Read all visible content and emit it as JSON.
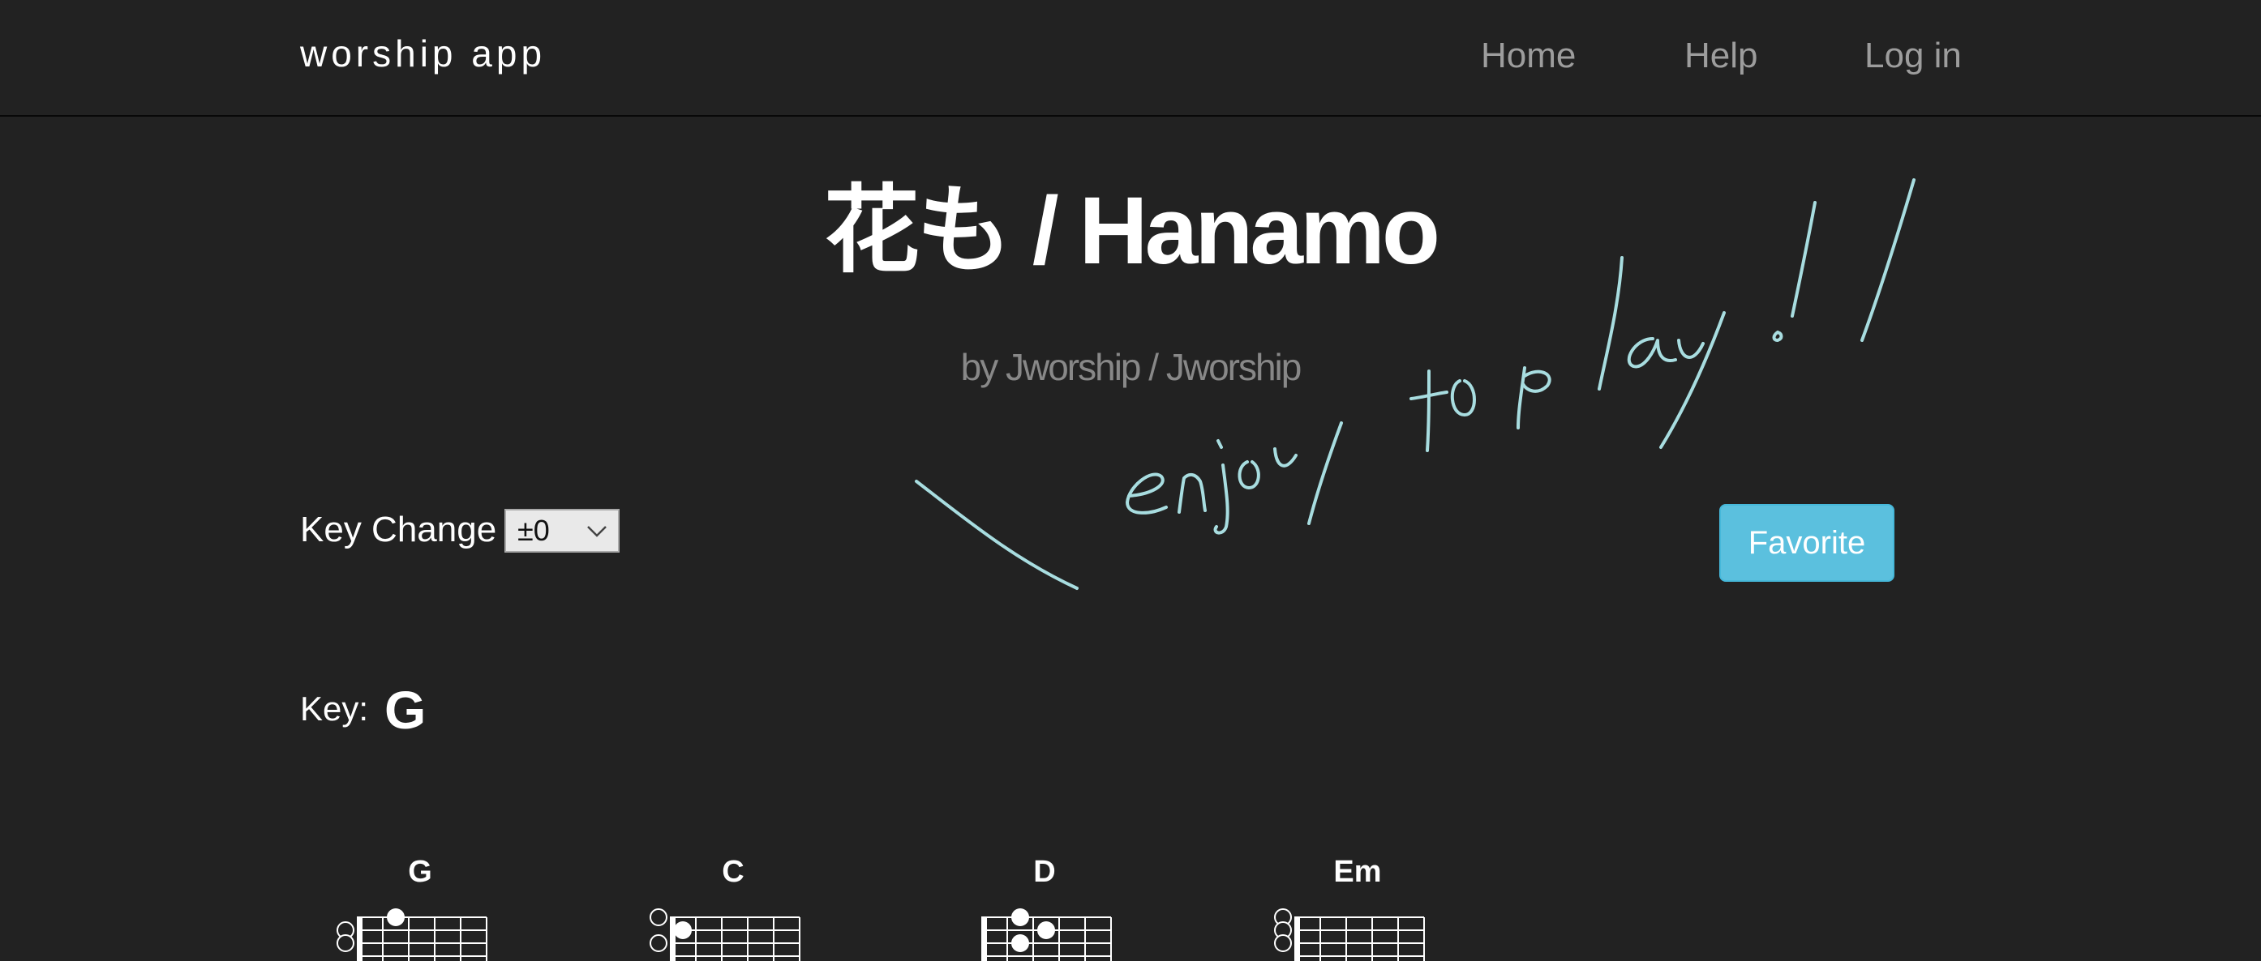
{
  "navbar": {
    "brand": "worship app",
    "links": [
      "Home",
      "Help",
      "Log in"
    ]
  },
  "song": {
    "title": "花も / Hanamo",
    "artist": "by Jworship / Jworship"
  },
  "annotation": {
    "handwritten_text": "\\ enjoy to play!!",
    "color": "#a8dde0"
  },
  "controls": {
    "key_change_label": "Key Change",
    "key_change_value": "±0",
    "favorite_label": "Favorite"
  },
  "key": {
    "label": "Key:",
    "value": "G"
  },
  "chords": [
    {
      "name": "G"
    },
    {
      "name": "C"
    },
    {
      "name": "D"
    },
    {
      "name": "Em"
    }
  ],
  "colors": {
    "background": "#222222",
    "nav_link": "#9d9d9d",
    "artist": "#888888",
    "favorite": "#5bc0de"
  }
}
